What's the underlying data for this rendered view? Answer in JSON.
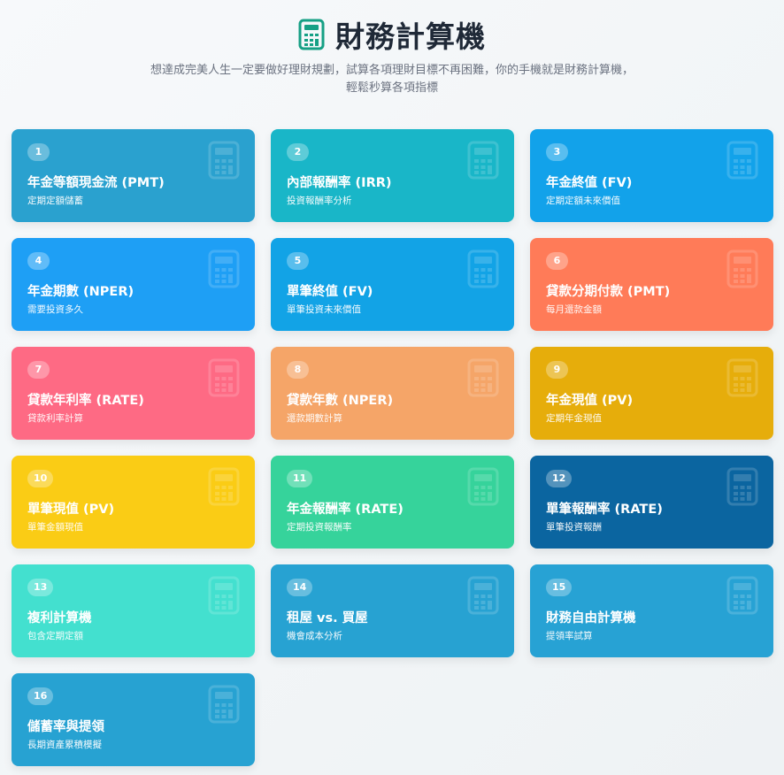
{
  "header": {
    "title": "財務計算機",
    "subtitle_line1": "想達成完美人生一定要做好理財規劃，試算各項理財目標不再困難，你的手機就是財務計算機，",
    "subtitle_line2": "輕鬆秒算各項指標",
    "icon": "calculator-icon",
    "icon_color": "#16a085"
  },
  "cards": [
    {
      "num": "1",
      "title": "年金等額現金流 (PMT)",
      "desc": "定期定額儲蓄",
      "color": "#2aa1cf",
      "icon": "calculator-icon"
    },
    {
      "num": "2",
      "title": "內部報酬率 (IRR)",
      "desc": "投資報酬率分析",
      "color": "#19b6c8",
      "icon": "calculator-icon"
    },
    {
      "num": "3",
      "title": "年金終值 (FV)",
      "desc": "定期定額未來價值",
      "color": "#12a2ea",
      "icon": "calculator-icon"
    },
    {
      "num": "4",
      "title": "年金期數 (NPER)",
      "desc": "需要投資多久",
      "color": "#1e9ff5",
      "icon": "calculator-icon"
    },
    {
      "num": "5",
      "title": "單筆終值 (FV)",
      "desc": "單筆投資未來價值",
      "color": "#12a3e6",
      "icon": "calculator-icon"
    },
    {
      "num": "6",
      "title": "貸款分期付款 (PMT)",
      "desc": "每月還款金額",
      "color": "#ff7b58",
      "icon": "calculator-icon"
    },
    {
      "num": "7",
      "title": "貸款年利率 (RATE)",
      "desc": "貸款利率計算",
      "color": "#fe6a84",
      "icon": "calculator-icon"
    },
    {
      "num": "8",
      "title": "貸款年數 (NPER)",
      "desc": "還款期數計算",
      "color": "#f5a568",
      "icon": "calculator-icon"
    },
    {
      "num": "9",
      "title": "年金現值 (PV)",
      "desc": "定期年金現值",
      "color": "#e6ad0b",
      "icon": "calculator-icon"
    },
    {
      "num": "10",
      "title": "單筆現值 (PV)",
      "desc": "單筆金額現值",
      "color": "#facc15",
      "icon": "calculator-icon"
    },
    {
      "num": "11",
      "title": "年金報酬率 (RATE)",
      "desc": "定期投資報酬率",
      "color": "#36d39b",
      "icon": "calculator-icon"
    },
    {
      "num": "12",
      "title": "單筆報酬率 (RATE)",
      "desc": "單筆投資報酬",
      "color": "#0b65a0",
      "icon": "calculator-icon"
    },
    {
      "num": "13",
      "title": "複利計算機",
      "desc": "包含定期定額",
      "color": "#43e0cf",
      "icon": "calculator-icon"
    },
    {
      "num": "14",
      "title": "租屋 vs. 買屋",
      "desc": "機會成本分析",
      "color": "#27a2d2",
      "icon": "calculator-icon"
    },
    {
      "num": "15",
      "title": "財務自由計算機",
      "desc": "提領率試算",
      "color": "#27a2d4",
      "icon": "calculator-icon"
    },
    {
      "num": "16",
      "title": "儲蓄率與提領",
      "desc": "長期資產累積模擬",
      "color": "#27a2d2",
      "icon": "calculator-icon"
    }
  ]
}
